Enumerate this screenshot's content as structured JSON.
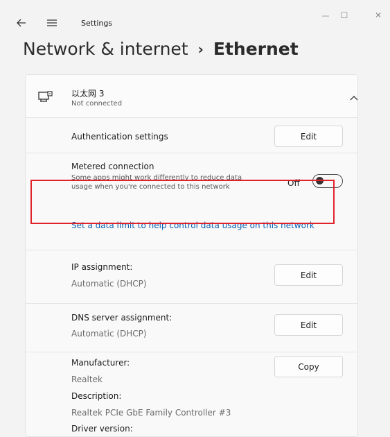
{
  "window": {
    "app_title": "Settings",
    "minimize_glyph": "—",
    "maximize_glyph": "☐",
    "close_glyph": "✕"
  },
  "breadcrumb": {
    "parent": "Network & internet",
    "separator": "›",
    "current": "Ethernet"
  },
  "adapter": {
    "name": "以太网 3",
    "status": "Not connected",
    "icon": "ethernet-icon"
  },
  "authentication": {
    "label": "Authentication settings",
    "button": "Edit"
  },
  "metered": {
    "label": "Metered connection",
    "description": "Some apps might work differently to reduce data usage when you're connected to this network",
    "state_label": "Off",
    "enabled": false,
    "data_limit_link": "Set a data limit to help control data usage on this network"
  },
  "ip_assignment": {
    "label": "IP assignment:",
    "value": "Automatic (DHCP)",
    "button": "Edit"
  },
  "dns_assignment": {
    "label": "DNS server assignment:",
    "value": "Automatic (DHCP)",
    "button": "Edit"
  },
  "details": {
    "manufacturer_label": "Manufacturer:",
    "manufacturer_value": "Realtek",
    "description_label": "Description:",
    "description_value": "Realtek PCIe GbE Family Controller #3",
    "driver_label": "Driver version:",
    "copy_button": "Copy"
  },
  "colors": {
    "accent_link": "#0a5fb4",
    "highlight_border": "#e0222a",
    "background": "#f3f3f3"
  }
}
